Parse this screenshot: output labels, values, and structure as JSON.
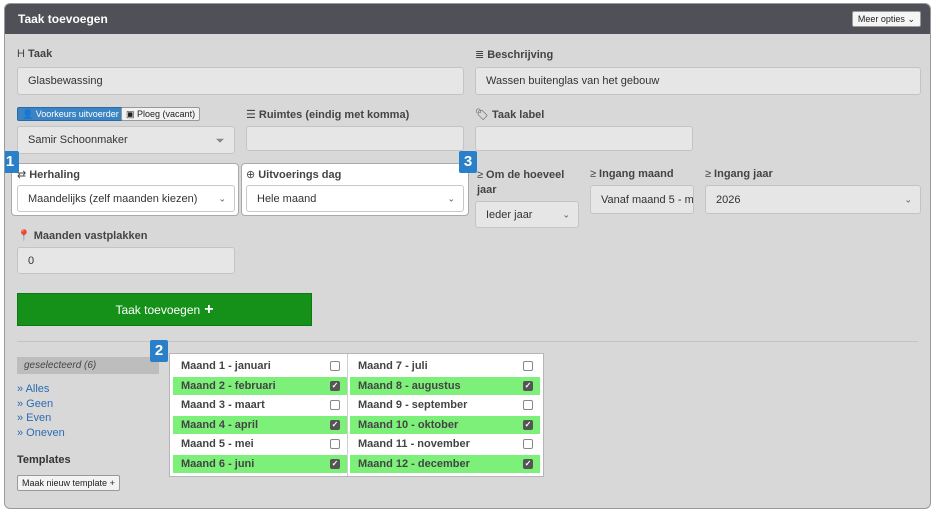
{
  "header": {
    "title": "Taak toevoegen",
    "more_options": "Meer opties"
  },
  "taak": {
    "label": "Taak",
    "value": "Glasbewassing"
  },
  "beschrijving": {
    "label": "Beschrijving",
    "value": "Wassen buitenglas van het gebouw"
  },
  "uitvoerder": {
    "toggle_voorkeur": "Voorkeurs uitvoerder",
    "toggle_ploeg": "Ploeg (vacant)",
    "selected": "Samir Schoonmaker"
  },
  "ruimtes": {
    "label": "Ruimtes (eindig met komma)",
    "value": ""
  },
  "taak_label": {
    "label": "Taak label",
    "value": ""
  },
  "herhaling": {
    "label": "Herhaling",
    "selected": "Maandelijks (zelf maanden kiezen)"
  },
  "uitvoerings_dag": {
    "label": "Uitvoerings dag",
    "selected": "Hele maand"
  },
  "om_de_hoeveel": {
    "label_line1": "Om de hoeveel",
    "label_line2": "jaar",
    "selected": "Ieder jaar"
  },
  "ingang_maand": {
    "label": "Ingang maand",
    "selected": "Vanaf maand 5 - m"
  },
  "ingang_jaar": {
    "label": "Ingang jaar",
    "selected": "2026"
  },
  "maanden_vastplakken": {
    "label": "Maanden vastplakken",
    "value": "0"
  },
  "submit": {
    "label": "Taak toevoegen"
  },
  "badges": [
    "1",
    "2",
    "3"
  ],
  "selection": {
    "selected_label": "geselecteerd (6)",
    "links": [
      "» Alles",
      "» Geen",
      "» Even",
      "» Oneven"
    ]
  },
  "templates": {
    "label": "Templates",
    "new_button": "Maak nieuw template"
  },
  "months": [
    {
      "label": "Maand 1 - januari",
      "checked": false
    },
    {
      "label": "Maand 2 - februari",
      "checked": true
    },
    {
      "label": "Maand 3 - maart",
      "checked": false
    },
    {
      "label": "Maand 4 - april",
      "checked": true
    },
    {
      "label": "Maand 5 - mei",
      "checked": false
    },
    {
      "label": "Maand 6 - juni",
      "checked": true
    },
    {
      "label": "Maand 7 - juli",
      "checked": false
    },
    {
      "label": "Maand 8 - augustus",
      "checked": true
    },
    {
      "label": "Maand 9 - september",
      "checked": false
    },
    {
      "label": "Maand 10 - oktober",
      "checked": true
    },
    {
      "label": "Maand 11 - november",
      "checked": false
    },
    {
      "label": "Maand 12 - december",
      "checked": true
    }
  ],
  "colors": {
    "header_bg": "#4f5058",
    "accent_blue": "#3a83c4",
    "submit_green": "#15911a",
    "selected_month": "#7df07a"
  }
}
